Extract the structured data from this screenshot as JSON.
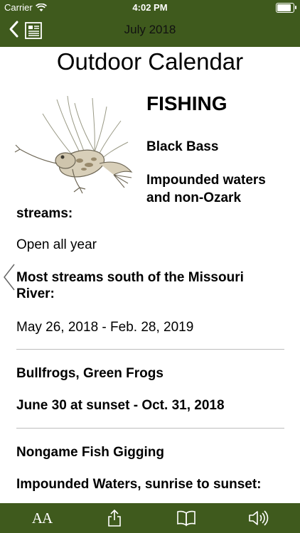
{
  "status": {
    "carrier": "Carrier",
    "time": "4:02 PM"
  },
  "nav": {
    "title": "July 2018"
  },
  "content": {
    "title": "Outdoor Calendar",
    "section": "FISHING",
    "species": "Black Bass",
    "impounded_line1": "Impounded waters",
    "impounded_line2": "and non-Ozark",
    "impounded_line3": "streams:",
    "open": "Open all year",
    "most_streams": "Most streams south of the Missouri River:",
    "may_dates": "May 26, 2018 - Feb. 28, 2019",
    "bullfrogs": "Bullfrogs, Green Frogs",
    "june_dates": "June 30 at sunset - Oct. 31, 2018",
    "nongame": "Nongame Fish Gigging",
    "impounded_sun": "Impounded Waters, sunrise to sunset:"
  },
  "toolbar": {
    "text_size_label": "AA"
  },
  "colors": {
    "bar": "#3f5a1d"
  },
  "icons": [
    "back-chevron-icon",
    "document-icon",
    "text-size-icon",
    "share-icon",
    "book-icon",
    "speaker-icon",
    "previous-page-chevron-icon"
  ]
}
